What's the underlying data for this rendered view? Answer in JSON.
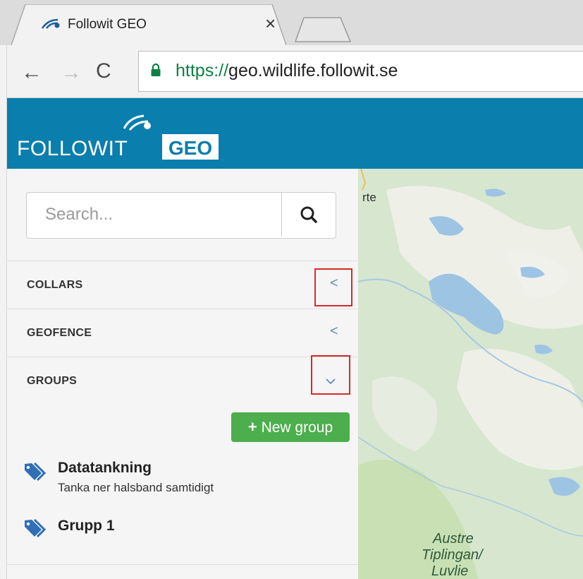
{
  "browser": {
    "tab_title": "Followit GEO",
    "tab_close": "×",
    "url_protocol": "https://",
    "url_host": "geo.wildlife.followit.se"
  },
  "app": {
    "brand_name": "FOLLOWIT",
    "brand_badge": "GEO",
    "header_color": "#0a7ead"
  },
  "search": {
    "placeholder": "Search..."
  },
  "sections": [
    {
      "label": "COLLARS",
      "state": "collapsed"
    },
    {
      "label": "GEOFENCE",
      "state": "collapsed"
    },
    {
      "label": "GROUPS",
      "state": "expanded"
    }
  ],
  "groups": {
    "new_button_label": "New group",
    "new_button_icon": "+",
    "items": [
      {
        "name": "Datatankning",
        "description": "Tanka ner halsband samtidigt"
      },
      {
        "name": "Grupp 1",
        "description": ""
      }
    ]
  },
  "map": {
    "labels": [
      "rte",
      "Austre",
      "Tiplingan/",
      "Luvlie"
    ]
  }
}
